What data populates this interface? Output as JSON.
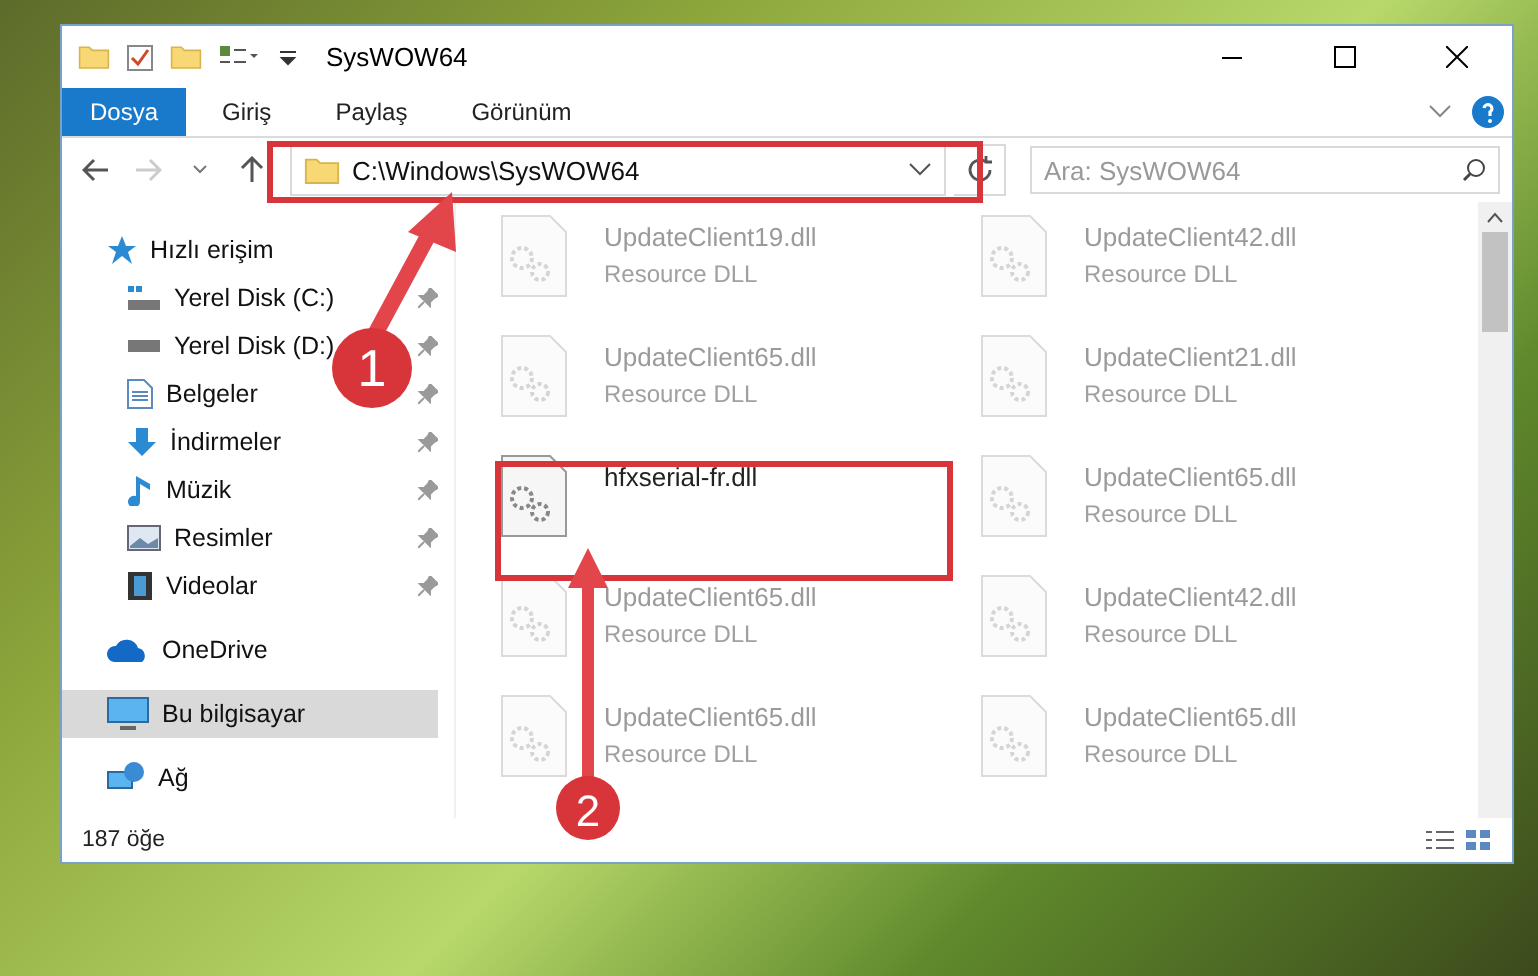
{
  "window": {
    "title": "SysWOW64"
  },
  "ribbon": {
    "tabs": [
      {
        "label": "Dosya",
        "selected": true
      },
      {
        "label": "Giriş",
        "selected": false
      },
      {
        "label": "Paylaş",
        "selected": false
      },
      {
        "label": "Görünüm",
        "selected": false
      }
    ]
  },
  "address": {
    "path": "C:\\Windows\\SysWOW64"
  },
  "search": {
    "placeholder": "Ara: SysWOW64"
  },
  "sidebar": {
    "items": [
      {
        "label": "Hızlı erişim",
        "kind": "star",
        "selected": false,
        "children": [
          {
            "label": "Yerel Disk (C:)",
            "kind": "system-drive",
            "selected": false,
            "pinned": true
          },
          {
            "label": "Yerel Disk (D:)",
            "kind": "drive",
            "selected": false,
            "pinned": true
          },
          {
            "label": "Belgeler",
            "kind": "document",
            "selected": false,
            "pinned": true
          },
          {
            "label": "İndirmeler",
            "kind": "download",
            "selected": false,
            "pinned": true
          },
          {
            "label": "Müzik",
            "kind": "music",
            "selected": false,
            "pinned": true
          },
          {
            "label": "Resimler",
            "kind": "picture",
            "selected": false,
            "pinned": true
          },
          {
            "label": "Videolar",
            "kind": "video",
            "selected": false,
            "pinned": true
          }
        ]
      },
      {
        "label": "OneDrive",
        "kind": "cloud",
        "selected": false
      },
      {
        "label": "Bu bilgisayar",
        "kind": "computer",
        "selected": true
      },
      {
        "label": "Ağ",
        "kind": "network",
        "selected": false
      }
    ]
  },
  "files": [
    {
      "name": "UpdateClient19.dll",
      "type": "Resource DLL",
      "dimmed": true
    },
    {
      "name": "UpdateClient42.dll",
      "type": "Resource DLL",
      "dimmed": true
    },
    {
      "name": "UpdateClient65.dll",
      "type": "Resource DLL",
      "dimmed": true
    },
    {
      "name": "UpdateClient21.dll",
      "type": "Resource DLL",
      "dimmed": true
    },
    {
      "name": "hfxserial-fr.dll",
      "dimmed": false
    },
    {
      "name": "UpdateClient65.dll",
      "type": "Resource DLL",
      "dimmed": true
    },
    {
      "name": "UpdateClient65.dll",
      "type": "Resource DLL",
      "dimmed": true
    },
    {
      "name": "UpdateClient42.dll",
      "type": "Resource DLL",
      "dimmed": true
    },
    {
      "name": "UpdateClient65.dll",
      "type": "Resource DLL",
      "dimmed": true
    },
    {
      "name": "UpdateClient65.dll",
      "type": "Resource DLL",
      "dimmed": true
    }
  ],
  "status_bar": {
    "count": "187 öğe"
  },
  "annotations": [
    {
      "number": "1"
    },
    {
      "number": "2"
    }
  ]
}
